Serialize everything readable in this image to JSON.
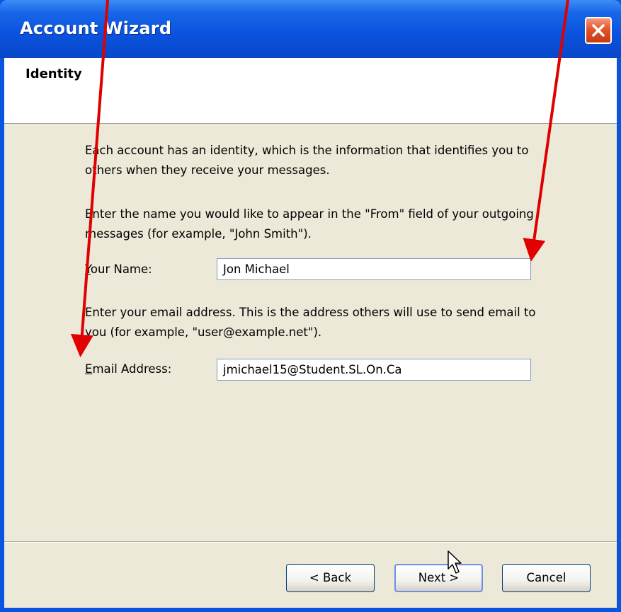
{
  "window": {
    "title": "Account Wizard",
    "close_icon": "close-x-icon"
  },
  "page": {
    "title": "Identity"
  },
  "content": {
    "intro": "Each account has an identity, which is the information that identifies you to others when they receive your messages.",
    "name_instruction": "Enter the name you would like to appear in the \"From\" field of your outgoing messages (for example, \"John Smith\").",
    "email_instruction": "Enter your email address. This is the address others will use to send email to you (for example, \"user@example.net\")."
  },
  "fields": {
    "name": {
      "label_accel": "Y",
      "label_rest": "our Name:",
      "value": "Jon Michael"
    },
    "email": {
      "label_accel": "E",
      "label_rest": "mail Address:",
      "value": "jmichael15@Student.SL.On.Ca"
    }
  },
  "buttons": {
    "back": "< Back",
    "next": "Next >",
    "cancel": "Cancel"
  },
  "colors": {
    "titlebar": "#0a52de",
    "dialog_background": "#ece9d8",
    "annotation_arrow": "#e00000"
  }
}
